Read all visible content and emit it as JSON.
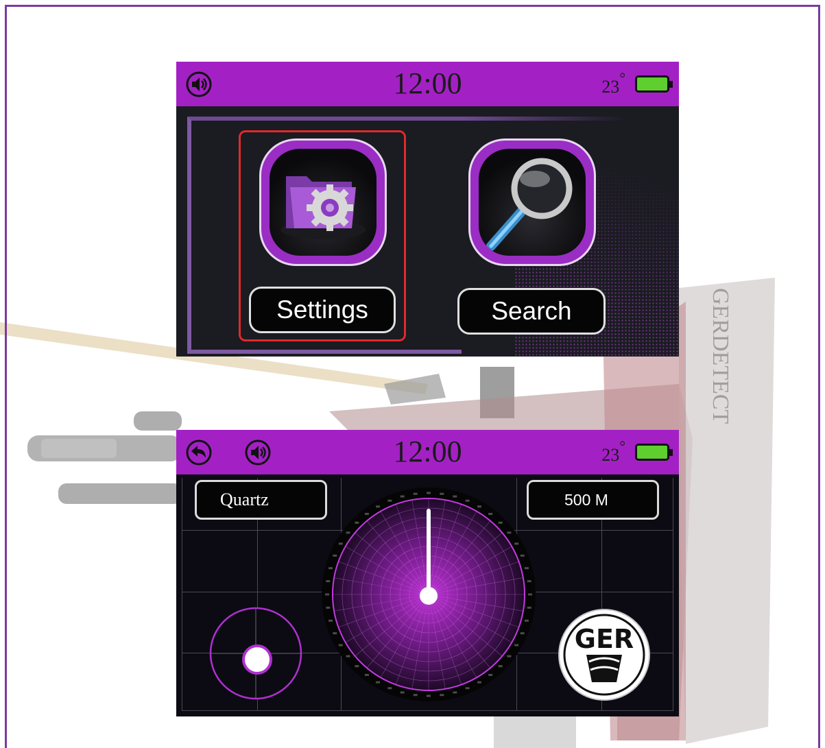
{
  "screen1": {
    "status_time": "12:00",
    "temperature": "23",
    "degree_symbol": "°",
    "icons": {
      "left": "speaker-icon",
      "battery": "battery-icon"
    },
    "apps": [
      {
        "label": "Settings",
        "icon": "folder-gear-icon",
        "selected": true
      },
      {
        "label": "Search",
        "icon": "magnifier-icon",
        "selected": false
      }
    ]
  },
  "screen2": {
    "status_time": "12:00",
    "temperature": "23",
    "degree_symbol": "°",
    "icons": {
      "back": "back-arrow-icon",
      "speaker": "speaker-icon",
      "battery": "battery-icon"
    },
    "target_label": "Quartz",
    "distance_label": "500 M",
    "logo_text": "GER",
    "colors": {
      "accent": "#a321c4",
      "battery": "#5fcf2f",
      "selection": "#e02a2a"
    }
  },
  "background": {
    "device_side_text": "GERDETECT"
  }
}
